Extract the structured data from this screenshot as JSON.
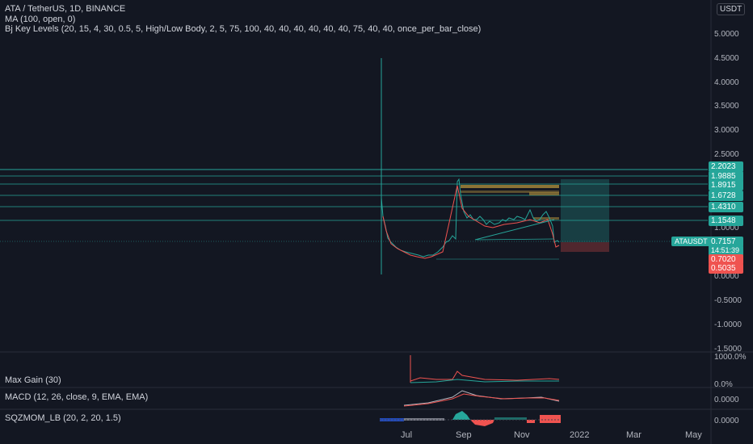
{
  "header": {
    "symbol_line": "ATA / TetherUS, 1D, BINANCE",
    "indicator_ma": "MA (100, open, 0)",
    "indicator_levels": "Bj Key Levels (20, 15, 4, 30, 0.5, 5, High/Low Body, 2, 5, 75, 100, 40, 40, 40, 40, 40, 40, 75, 40, 40, once_per_bar_close)"
  },
  "currency_button": "USDT",
  "price_axis": [
    "5.0000",
    "4.5000",
    "4.0000",
    "3.5000",
    "3.0000",
    "2.5000",
    "1.0000",
    "0.0000",
    "-0.5000",
    "-1.0000",
    "-1.5000"
  ],
  "level_tags": [
    {
      "value": "2.2023",
      "color": "#26a69a"
    },
    {
      "value": "1.9885",
      "color": "#26a69a"
    },
    {
      "value": "1.8915",
      "color": "#26a69a"
    },
    {
      "value": "1.6728",
      "color": "#26a69a"
    },
    {
      "value": "1.4310",
      "color": "#26a69a"
    },
    {
      "value": "1.1548",
      "color": "#26a69a"
    }
  ],
  "current_price": {
    "symbol": "ATAUSDT",
    "price": "0.7157",
    "countdown": "14:51:39"
  },
  "target_tags": [
    {
      "value": "0.7020",
      "color": "#ef5350"
    },
    {
      "value": "0.5035",
      "color": "#ef5350"
    }
  ],
  "panes": {
    "max_gain": {
      "title": "Max Gain (30)",
      "axis": [
        "1000.0%",
        "0.0%"
      ]
    },
    "macd": {
      "title": "MACD (12, 26, close, 9, EMA, EMA)",
      "axis": [
        "0.0000"
      ]
    },
    "sqzmom": {
      "title": "SQZMOM_LB (20, 2, 20, 1.5)",
      "axis": [
        "0.0000"
      ]
    }
  },
  "time_axis": [
    "Jul",
    "Sep",
    "Nov",
    "2022",
    "Mar",
    "May"
  ],
  "colors": {
    "up": "#26a69a",
    "down": "#ef5350",
    "level": "#26a69a",
    "box": "#a1843a"
  }
}
